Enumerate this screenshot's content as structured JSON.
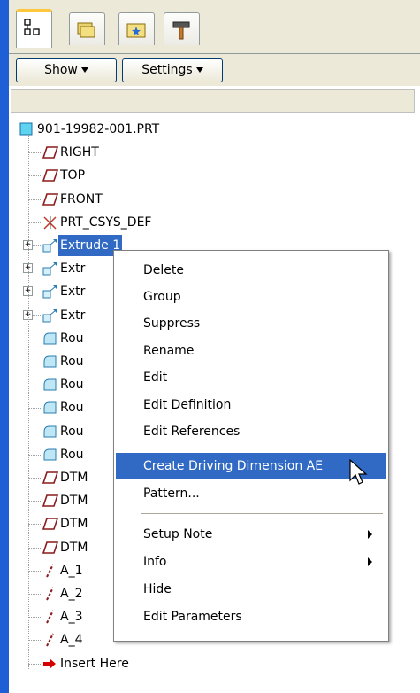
{
  "toolbar": {
    "show_label": "Show",
    "settings_label": "Settings"
  },
  "tree": {
    "root": "901-19982-001.PRT",
    "nodes": [
      {
        "label": "RIGHT",
        "icon": "datum-plane-icon"
      },
      {
        "label": "TOP",
        "icon": "datum-plane-icon"
      },
      {
        "label": "FRONT",
        "icon": "datum-plane-icon"
      },
      {
        "label": "PRT_CSYS_DEF",
        "icon": "csys-icon"
      },
      {
        "label": "Extrude 1",
        "icon": "extrude-icon"
      },
      {
        "label": "Extr",
        "icon": "extrude-icon"
      },
      {
        "label": "Extr",
        "icon": "extrude-icon"
      },
      {
        "label": "Extr",
        "icon": "extrude-icon"
      },
      {
        "label": "Rou",
        "icon": "round-icon"
      },
      {
        "label": "Rou",
        "icon": "round-icon"
      },
      {
        "label": "Rou",
        "icon": "round-icon"
      },
      {
        "label": "Rou",
        "icon": "round-icon"
      },
      {
        "label": "Rou",
        "icon": "round-icon"
      },
      {
        "label": "Rou",
        "icon": "round-icon"
      },
      {
        "label": "DTM",
        "icon": "datum-plane-icon"
      },
      {
        "label": "DTM",
        "icon": "datum-plane-icon"
      },
      {
        "label": "DTM",
        "icon": "datum-plane-icon"
      },
      {
        "label": "DTM",
        "icon": "datum-plane-icon"
      },
      {
        "label": "A_1",
        "icon": "datum-axis-icon"
      },
      {
        "label": "A_2",
        "icon": "datum-axis-icon"
      },
      {
        "label": "A_3",
        "icon": "datum-axis-icon"
      },
      {
        "label": "A_4",
        "icon": "datum-axis-icon"
      },
      {
        "label": "Insert Here",
        "icon": "insert-arrow-icon"
      }
    ]
  },
  "menu": {
    "items": [
      {
        "label": "Delete"
      },
      {
        "label": "Group"
      },
      {
        "label": "Suppress"
      },
      {
        "label": "Rename"
      },
      {
        "label": "Edit"
      },
      {
        "label": "Edit Definition"
      },
      {
        "label": "Edit References"
      },
      {
        "label": "Create Driving Dimension AE"
      },
      {
        "label": "Pattern..."
      },
      {
        "label": "Setup Note"
      },
      {
        "label": "Info"
      },
      {
        "label": "Hide"
      },
      {
        "label": "Edit Parameters"
      }
    ],
    "highlight_color": "#316ac5"
  }
}
